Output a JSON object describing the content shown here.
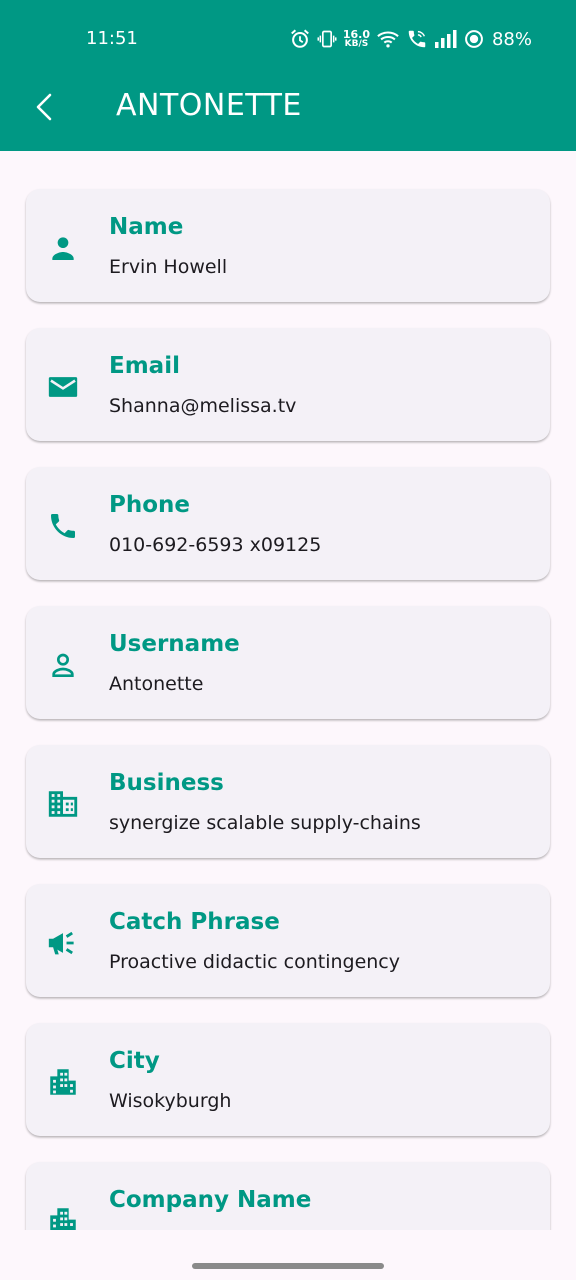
{
  "status_bar": {
    "time": "11:51",
    "net_speed_value": "16.0",
    "net_speed_unit": "KB/S",
    "battery": "88%"
  },
  "toolbar": {
    "title": "ANTONETTE"
  },
  "colors": {
    "primary": "#009884",
    "background": "#fdf7fc",
    "card": "#f4f1f7",
    "text": "#1d1b20"
  },
  "cards": [
    {
      "icon": "person-icon",
      "label": "Name",
      "value": "Ervin Howell"
    },
    {
      "icon": "email-icon",
      "label": "Email",
      "value": "Shanna@melissa.tv"
    },
    {
      "icon": "phone-icon",
      "label": "Phone",
      "value": "010-692-6593 x09125"
    },
    {
      "icon": "person-outline-icon",
      "label": "Username",
      "value": "Antonette"
    },
    {
      "icon": "business-icon",
      "label": "Business",
      "value": "synergize scalable supply-chains"
    },
    {
      "icon": "campaign-icon",
      "label": "Catch Phrase",
      "value": "Proactive didactic contingency"
    },
    {
      "icon": "city-icon",
      "label": "City",
      "value": "Wisokyburgh"
    },
    {
      "icon": "city-icon",
      "label": "Company Name",
      "value": ""
    }
  ]
}
